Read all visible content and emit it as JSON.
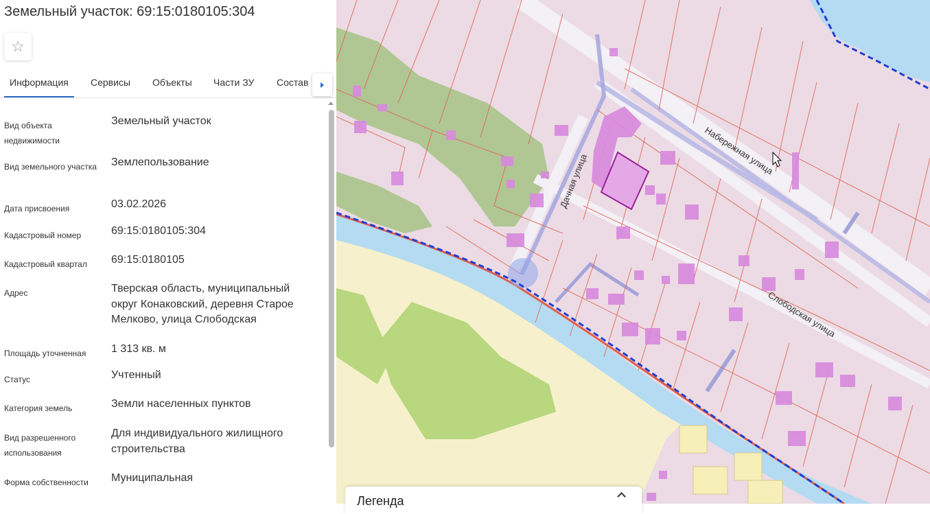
{
  "panel": {
    "title": "Земельный участок: 69:15:0180105:304",
    "favorite_icon": "☆",
    "tabs": [
      "Информация",
      "Сервисы",
      "Объекты",
      "Части ЗУ",
      "Состав"
    ],
    "fields": [
      {
        "label": "Вид объекта недвижимости",
        "value": "Земельный участок"
      },
      {
        "label": "Вид земельного участка",
        "value": "Землепользование"
      },
      {
        "label": "Дата присвоения",
        "value": "03.02.2026"
      },
      {
        "label": "Кадастровый номер",
        "value": "69:15:0180105:304"
      },
      {
        "label": "Кадастровый квартал",
        "value": "69:15:0180105"
      },
      {
        "label": "Адрес",
        "value": "Тверская область, муниципальный округ Конаковский, деревня Старое Мелково, улица Слободская"
      },
      {
        "label": "Площадь уточненная",
        "value": "1 313 кв. м"
      },
      {
        "label": "Статус",
        "value": "Учтенный"
      },
      {
        "label": "Категория земель",
        "value": "Земли населенных пунктов"
      },
      {
        "label": "Вид разрешенного использования",
        "value": "Для индивидуального жилищного строительства"
      },
      {
        "label": "Форма собственности",
        "value": "Муниципальная"
      }
    ]
  },
  "map": {
    "street_labels": [
      "Набережная улица",
      "Дачная улица",
      "Слободская улица"
    ],
    "legend_title": "Легенда",
    "colors": {
      "parcel_fill": "#ecdbe4",
      "parcel_border": "#e0604d",
      "building": "#d88ade",
      "selected_border": "#9b1f9b",
      "water": "#b5dbf2",
      "green": "#8fb86a",
      "field": "#f5f1c8",
      "boundary": "#1f3fd6"
    }
  }
}
